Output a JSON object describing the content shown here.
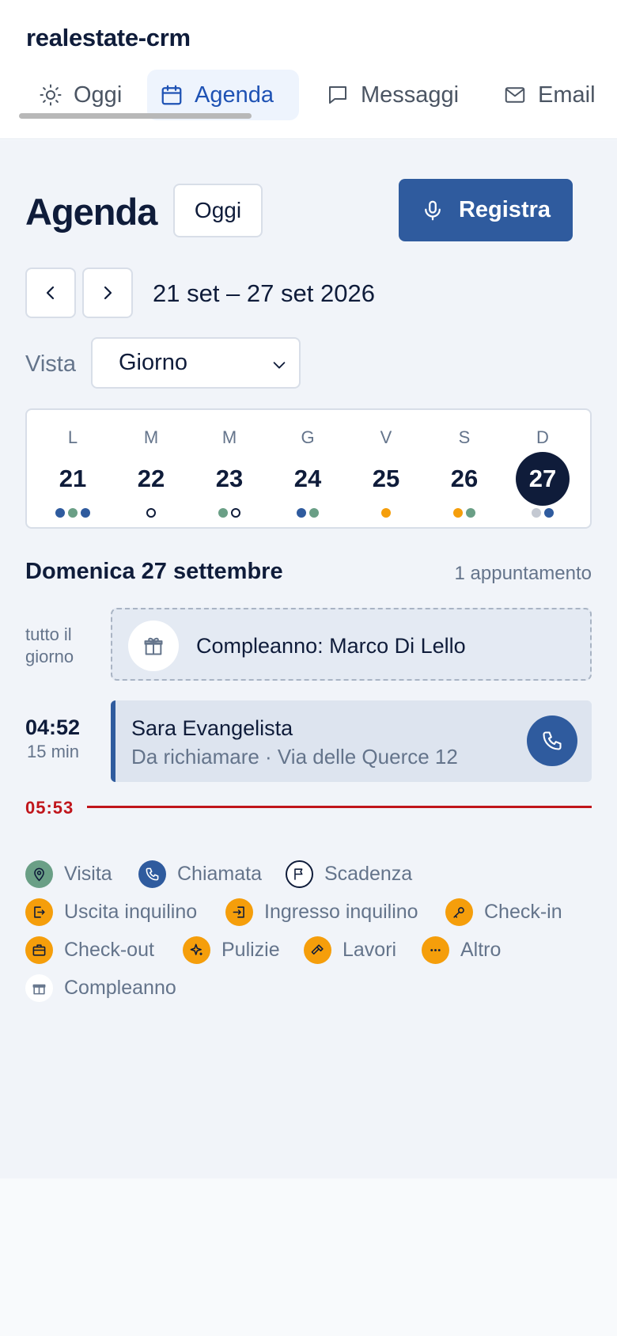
{
  "app": {
    "title": "realestate-crm"
  },
  "tabs": [
    {
      "label": "Oggi",
      "icon": "sun-icon",
      "active": false
    },
    {
      "label": "Agenda",
      "icon": "calendar-icon",
      "active": true
    },
    {
      "label": "Messaggi",
      "icon": "chat-icon",
      "active": false
    },
    {
      "label": "Email",
      "icon": "mail-icon",
      "active": false
    }
  ],
  "header": {
    "title": "Agenda",
    "today_label": "Oggi",
    "record_label": "Registra"
  },
  "range": {
    "label": "21 set – 27 set 2026"
  },
  "view": {
    "label": "Vista",
    "selected": "Giorno"
  },
  "week": {
    "days": [
      {
        "letter": "L",
        "num": "21",
        "dots": [
          "#2f5b9e",
          "#6a9f86",
          "#2f5b9e"
        ]
      },
      {
        "letter": "M",
        "num": "22",
        "dots": [
          "ring"
        ]
      },
      {
        "letter": "M",
        "num": "23",
        "dots": [
          "#6a9f86",
          "ring"
        ]
      },
      {
        "letter": "G",
        "num": "24",
        "dots": [
          "#2f5b9e",
          "#6a9f86"
        ]
      },
      {
        "letter": "V",
        "num": "25",
        "dots": [
          "#f59e0b"
        ]
      },
      {
        "letter": "S",
        "num": "26",
        "dots": [
          "#f59e0b",
          "#6a9f86"
        ]
      },
      {
        "letter": "D",
        "num": "27",
        "dots": [
          "#c4c9d2",
          "#2f5b9e"
        ],
        "selected": true
      }
    ]
  },
  "day": {
    "heading": "Domenica 27 settembre",
    "count": "1 appuntamento"
  },
  "allday": {
    "label": "tutto il giorno",
    "title": "Compleanno: Marco Di Lello"
  },
  "appointment": {
    "time": "04:52",
    "duration": "15 min",
    "name": "Sara Evangelista",
    "detail": "Da richiamare · Via delle Querce 12"
  },
  "now": {
    "time": "05:53"
  },
  "legend": [
    {
      "label": "Visita",
      "icon": "map-pin-icon",
      "color": "#6a9f86"
    },
    {
      "label": "Chiamata",
      "icon": "phone-icon",
      "color": "#2f5b9e"
    },
    {
      "label": "Scadenza",
      "icon": "flag-icon",
      "color": "#ffffff"
    },
    {
      "label": "Uscita inquilino",
      "icon": "logout-icon",
      "color": "#f59e0b"
    },
    {
      "label": "Ingresso inquilino",
      "icon": "login-icon",
      "color": "#f59e0b"
    },
    {
      "label": "Check-in",
      "icon": "key-icon",
      "color": "#f59e0b"
    },
    {
      "label": "Check-out",
      "icon": "briefcase-icon",
      "color": "#f59e0b"
    },
    {
      "label": "Pulizie",
      "icon": "sparkle-icon",
      "color": "#f59e0b"
    },
    {
      "label": "Lavori",
      "icon": "hammer-icon",
      "color": "#f59e0b"
    },
    {
      "label": "Altro",
      "icon": "more-icon",
      "color": "#f59e0b"
    },
    {
      "label": "Compleanno",
      "icon": "gift-icon",
      "color": "#ffffff"
    }
  ],
  "colors": {
    "primary": "#2f5b9e",
    "navy": "#0f1c3a",
    "now_line": "#c0151b",
    "orange": "#f59e0b",
    "green": "#6a9f86"
  }
}
